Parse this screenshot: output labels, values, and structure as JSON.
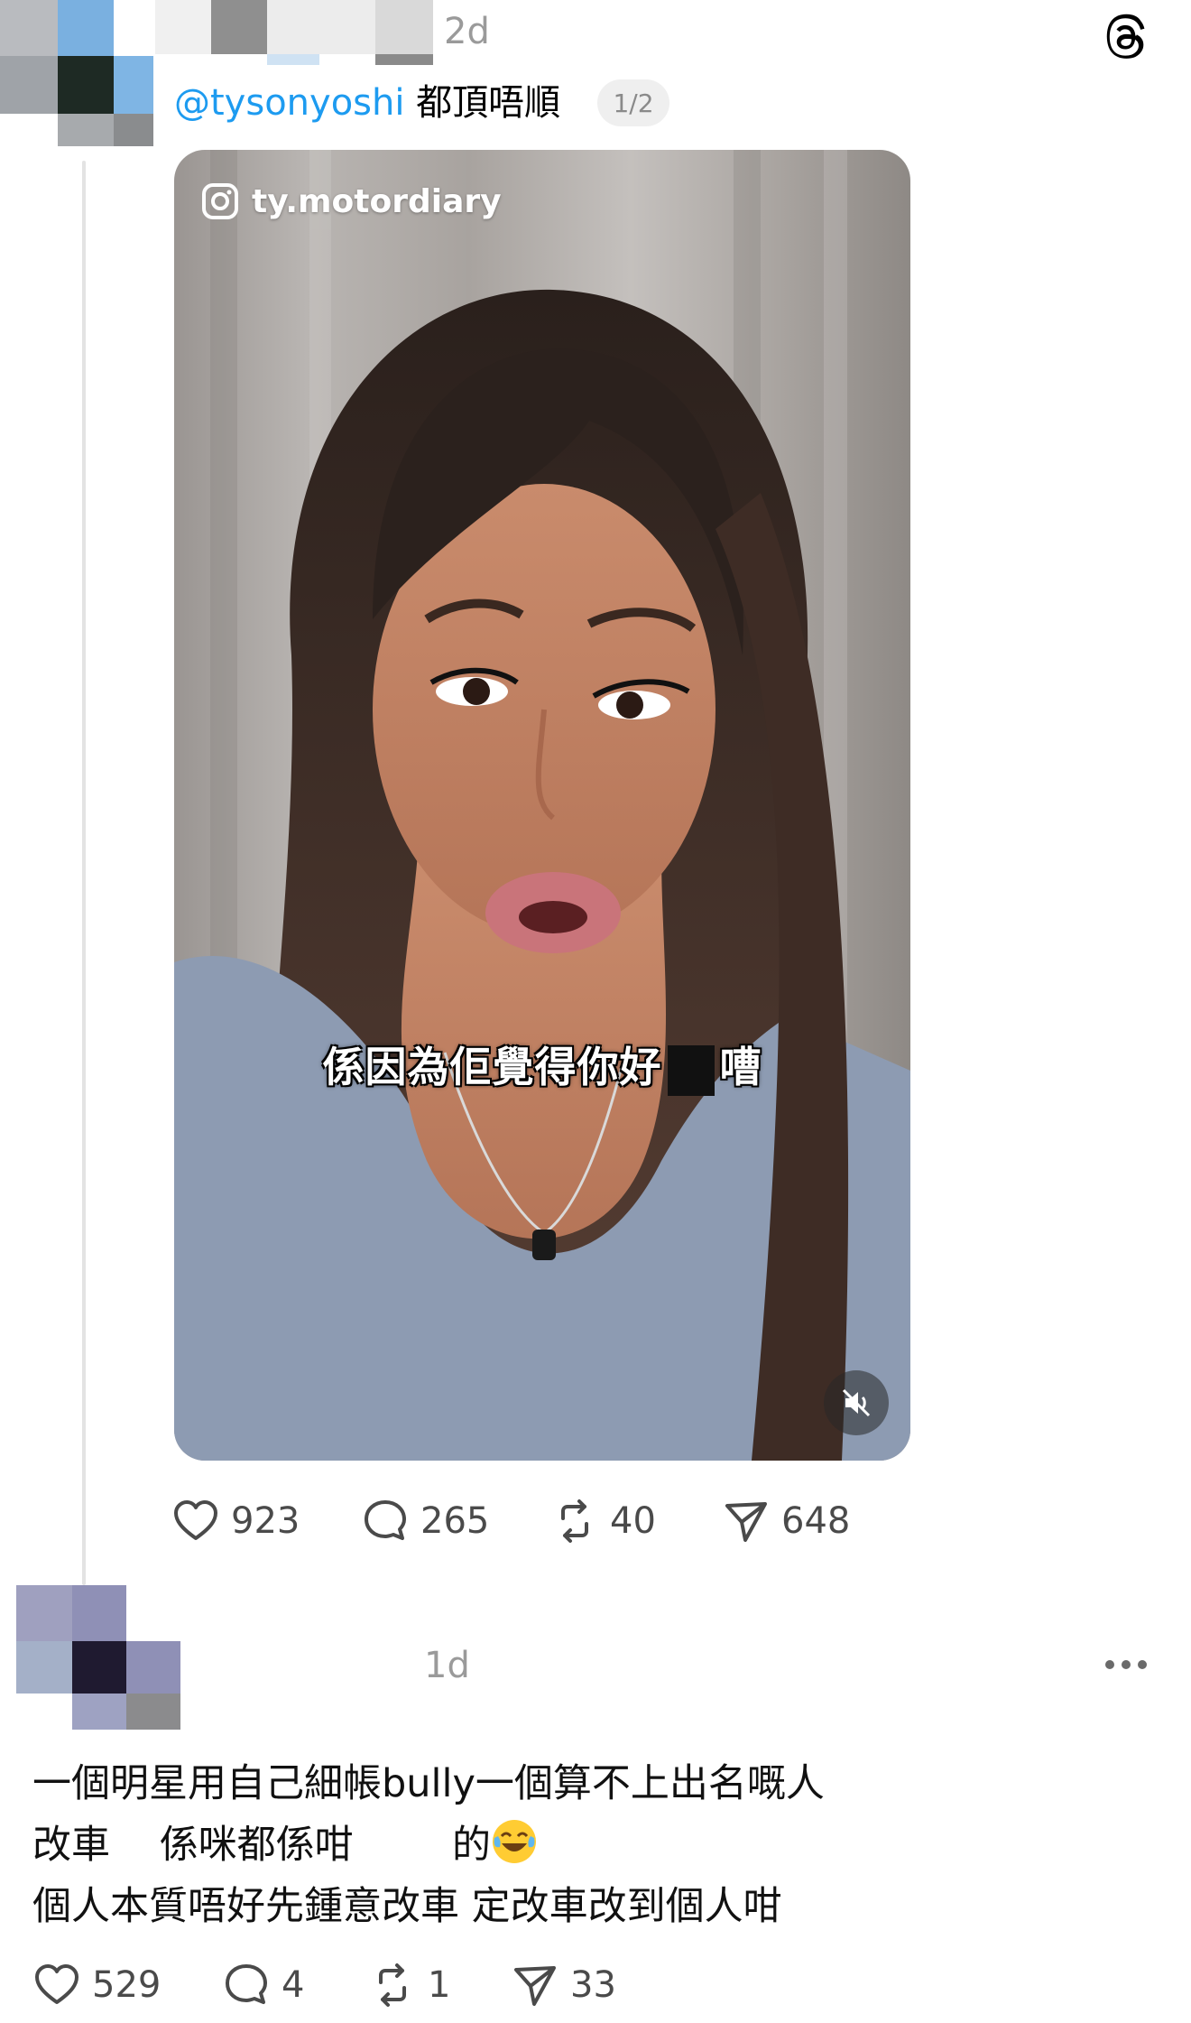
{
  "post": {
    "time": "2d",
    "mention": "@tysonyoshi",
    "text": " 都頂唔順",
    "media_counter": "1/2",
    "video": {
      "watermark": "ty.motordiary",
      "subtitle_before": "係因為佢覺得你好",
      "subtitle_after": "嘈",
      "muted": true
    },
    "actions": {
      "likes": "923",
      "comments": "265",
      "reposts": "40",
      "shares": "648"
    }
  },
  "reply": {
    "time": "1d",
    "line1": "一個明星用自己細帳bully一個算不上出名嘅人",
    "line2_a": "改車",
    "line2_b": "係咪都係咁",
    "line2_c": "的",
    "line3": "個人本質唔好先鍾意改車 定改車改到個人咁",
    "actions": {
      "likes": "529",
      "comments": "4",
      "reposts": "1",
      "shares": "33"
    }
  },
  "icons": {
    "app_logo": "threads-icon",
    "like": "heart-icon",
    "comment": "comment-icon",
    "repost": "repost-icon",
    "share": "share-icon",
    "more": "more-icon",
    "mute": "muted-speaker-icon",
    "instagram": "instagram-icon",
    "emoji": "tears-of-joy-emoji"
  },
  "colors": {
    "mention": "#1d9bf0",
    "secondary_text": "#9a9a9a",
    "icon": "#4a4a4a"
  }
}
